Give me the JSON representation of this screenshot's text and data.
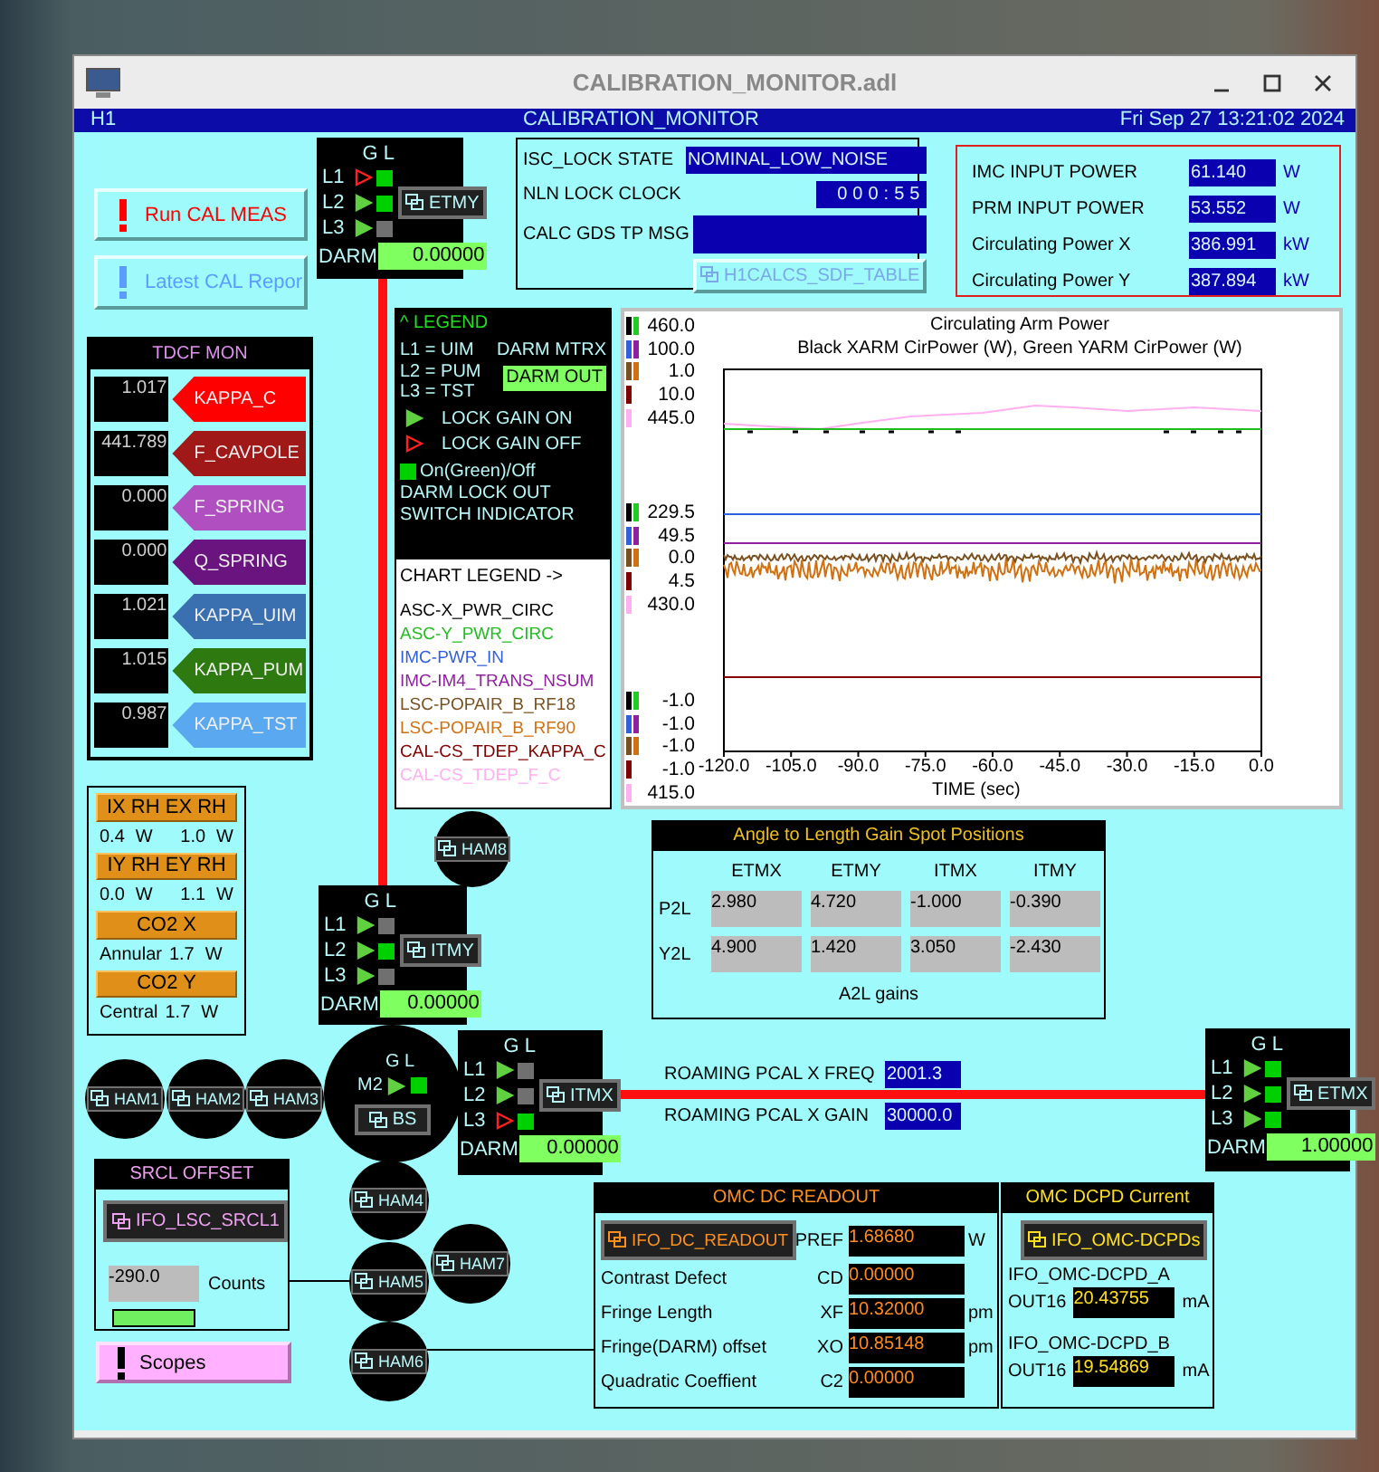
{
  "window": {
    "title": "CALIBRATION_MONITOR.adl"
  },
  "header": {
    "site": "H1",
    "title": "CALIBRATION_MONITOR",
    "datetime": "Fri Sep 27 13:21:02 2024"
  },
  "shell_buttons": [
    {
      "label": "Run CAL MEAS",
      "color": "#ff0000"
    },
    {
      "label": "Latest CAL Repor",
      "color": "#5a9cff"
    }
  ],
  "tdcf_mon": {
    "title": "TDCF MON",
    "rows": [
      {
        "value": "1.017",
        "label": "KAPPA_C",
        "color": "#ff0000"
      },
      {
        "value": "441.789",
        "label": "F_CAVPOLE",
        "color": "#a01818"
      },
      {
        "value": "0.000",
        "label": "F_SPRING",
        "color": "#b050c0"
      },
      {
        "value": "0.000",
        "label": "Q_SPRING",
        "color": "#6a1480"
      },
      {
        "value": "1.021",
        "label": "KAPPA_UIM",
        "color": "#3a6fb0"
      },
      {
        "value": "1.015",
        "label": "KAPPA_PUM",
        "color": "#2e7a10"
      },
      {
        "value": "0.987",
        "label": "KAPPA_TST",
        "color": "#5aa8f0"
      }
    ]
  },
  "heaters": [
    {
      "label": "IX RH EX RH",
      "readings": [
        {
          "value": "0.4",
          "unit": "W"
        },
        {
          "value": "1.0",
          "unit": "W"
        }
      ]
    },
    {
      "label": "IY RH EY RH",
      "readings": [
        {
          "value": "0.0",
          "unit": "W"
        },
        {
          "value": "1.1",
          "unit": "W"
        }
      ]
    },
    {
      "label": "CO2 X",
      "readings": [
        {
          "prefix": "Annular",
          "value": "1.7",
          "unit": "W"
        }
      ]
    },
    {
      "label": "CO2 Y",
      "readings": [
        {
          "prefix": "Central",
          "value": "1.7",
          "unit": "W"
        }
      ]
    }
  ],
  "suspensions": [
    {
      "name": "ETMY",
      "header": "G L",
      "stages": [
        {
          "label": "L1",
          "gain_on": false,
          "locked": true
        },
        {
          "label": "L2",
          "gain_on": true,
          "locked": true
        },
        {
          "label": "L3",
          "gain_on": true,
          "locked": false
        }
      ],
      "darm_label": "DARM",
      "darm": "0.00000"
    },
    {
      "name": "ITMY",
      "header": "G L",
      "stages": [
        {
          "label": "L1",
          "gain_on": true,
          "locked": false
        },
        {
          "label": "L2",
          "gain_on": true,
          "locked": true
        },
        {
          "label": "L3",
          "gain_on": true,
          "locked": false
        }
      ],
      "darm_label": "DARM",
      "darm": "0.00000"
    },
    {
      "name": "ITMX",
      "header": "G L",
      "stages": [
        {
          "label": "L1",
          "gain_on": true,
          "locked": false
        },
        {
          "label": "L2",
          "gain_on": true,
          "locked": false
        },
        {
          "label": "L3",
          "gain_on": false,
          "locked": true
        }
      ],
      "darm_label": "DARM",
      "darm": "0.00000"
    },
    {
      "name": "ETMX",
      "header": "G L",
      "stages": [
        {
          "label": "L1",
          "gain_on": true,
          "locked": true
        },
        {
          "label": "L2",
          "gain_on": true,
          "locked": true
        },
        {
          "label": "L3",
          "gain_on": true,
          "locked": true
        }
      ],
      "darm_label": "DARM",
      "darm": "1.00000"
    }
  ],
  "beamsplitter": {
    "name": "BS",
    "header": "G L",
    "stages": [
      {
        "label": "M2",
        "gain_on": true,
        "locked": true
      }
    ]
  },
  "hams": [
    {
      "name": "HAM8"
    },
    {
      "name": "HAM1"
    },
    {
      "name": "HAM2"
    },
    {
      "name": "HAM3"
    },
    {
      "name": "HAM4"
    },
    {
      "name": "HAM7"
    },
    {
      "name": "HAM5"
    },
    {
      "name": "HAM6"
    }
  ],
  "isc_lock": {
    "rows": [
      {
        "label": "ISC_LOCK STATE",
        "value": "NOMINAL_LOW_NOISE"
      },
      {
        "label": "NLN LOCK CLOCK",
        "value": "000:55"
      },
      {
        "label": "CALC GDS TP MSG"
      }
    ],
    "sdf_button": "H1CALCS_SDF_TABLE"
  },
  "power": [
    {
      "label": "IMC INPUT POWER",
      "value": "61.140",
      "unit": "W"
    },
    {
      "label": "PRM INPUT POWER",
      "value": "53.552",
      "unit": "W"
    },
    {
      "label": "Circulating Power X",
      "value": "386.991",
      "unit": "kW"
    },
    {
      "label": "Circulating Power Y",
      "value": "387.894",
      "unit": "kW"
    }
  ],
  "legend": {
    "title": "^ LEGEND",
    "stages": [
      "L1 = UIM",
      "L2 = PUM",
      "L3 = TST"
    ],
    "darm_mtrx": "DARM MTRX",
    "darm_out": "DARM OUT",
    "gain_on": "LOCK GAIN ON",
    "gain_off": "LOCK GAIN OFF",
    "switch_lines": [
      "On(Green)/Off",
      "DARM LOCK OUT",
      "SWITCH INDICATOR"
    ],
    "chart_legend": "CHART LEGEND  ->",
    "channels": [
      {
        "name": "ASC-X_PWR_CIRC",
        "color": "#000000"
      },
      {
        "name": "ASC-Y_PWR_CIRC",
        "color": "#22bb22"
      },
      {
        "name": "IMC-PWR_IN",
        "color": "#3060e0"
      },
      {
        "name": "IMC-IM4_TRANS_NSUM",
        "color": "#9020a0"
      },
      {
        "name": "LSC-POPAIR_B_RF18",
        "color": "#7a5020"
      },
      {
        "name": "LSC-POPAIR_B_RF90",
        "color": "#d07010"
      },
      {
        "name": "CAL-CS_TDEP_KAPPA_C",
        "color": "#800000"
      },
      {
        "name": "CAL-CS_TDEP_F_C",
        "color": "#ffb0f0"
      }
    ]
  },
  "chart": {
    "title": "Circulating Arm Power",
    "subtitle": "Black XARM CirPower (W), Green YARM CirPower (W)",
    "scales": [
      {
        "traces": [
          {
            "color": "#000000"
          },
          {
            "color": "#22cc22"
          }
        ],
        "labels": [
          "460.0",
          "229.5",
          "-1.0"
        ]
      },
      {
        "traces": [
          {
            "color": "#3060e0"
          },
          {
            "color": "#9020a0"
          }
        ],
        "labels": [
          "100.0",
          "49.5",
          "-1.0"
        ]
      },
      {
        "traces": [
          {
            "color": "#7a5020"
          },
          {
            "color": "#d07010"
          }
        ],
        "labels": [
          "1.0",
          "0.0",
          "-1.0"
        ]
      },
      {
        "traces": [
          {
            "color": "#800000"
          }
        ],
        "labels": [
          "10.0",
          "4.5",
          "-1.0"
        ]
      },
      {
        "traces": [
          {
            "color": "#ffb0f0"
          }
        ],
        "labels": [
          "445.0",
          "430.0",
          "415.0"
        ]
      }
    ],
    "xticks": [
      "-120.0",
      "-105.0",
      "-90.0",
      "-75.0",
      "-60.0",
      "-45.0",
      "-30.0",
      "-15.0",
      "0.0"
    ],
    "xlabel": "TIME (sec)"
  },
  "a2l": {
    "title": "Angle to Length Gain Spot Positions",
    "columns": [
      "ETMX",
      "ETMY",
      "ITMX",
      "ITMY"
    ],
    "rows": [
      {
        "label": "P2L",
        "values": [
          "2.980",
          "4.720",
          "-1.000",
          "-0.390"
        ]
      },
      {
        "label": "Y2L",
        "values": [
          "4.900",
          "1.420",
          "3.050",
          "-2.430"
        ]
      }
    ],
    "caption": "A2L gains"
  },
  "pcal": [
    {
      "label": "ROAMING PCAL X FREQ",
      "value": "2001.3"
    },
    {
      "label": "ROAMING PCAL X GAIN",
      "value": "30000.0"
    }
  ],
  "srcl": {
    "title": "SRCL OFFSET",
    "button": "IFO_LSC_SRCL1",
    "value": "-290.0",
    "unit": "Counts"
  },
  "scopes_button": {
    "label": "Scopes"
  },
  "omc_dc": {
    "title": "OMC DC READOUT",
    "button": "IFO_DC_READOUT",
    "rows": [
      {
        "code": "PREF",
        "value": "1.68680",
        "unit": "W"
      },
      {
        "label": "Contrast Defect",
        "code": "CD",
        "value": "0.00000"
      },
      {
        "label": "Fringe Length",
        "code": "XF",
        "value": "10.32000",
        "unit": "pm"
      },
      {
        "label": "Fringe(DARM) offset",
        "code": "XO",
        "value": "10.85148",
        "unit": "pm"
      },
      {
        "label": "Quadratic Coeffient",
        "code": "C2",
        "value": "0.00000"
      }
    ]
  },
  "omc_dcpd": {
    "title": "OMC DCPD Current",
    "button": "IFO_OMC-DCPDs",
    "channels": [
      {
        "name": "IFO_OMC-DCPD_A",
        "label": "OUT16",
        "value": "20.43755",
        "unit": "mA"
      },
      {
        "name": "IFO_OMC-DCPD_B",
        "label": "OUT16",
        "value": "19.54869",
        "unit": "mA"
      }
    ]
  }
}
